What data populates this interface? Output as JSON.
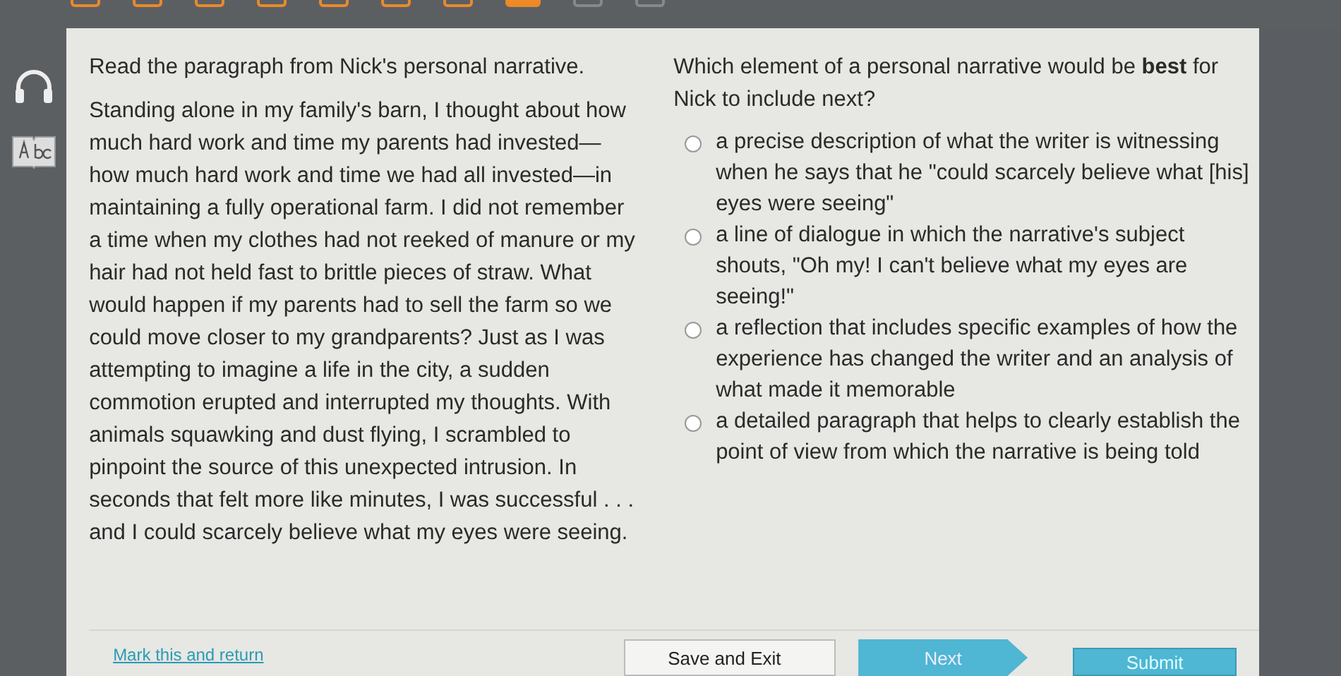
{
  "progress": [
    {
      "answered": true,
      "current": false
    },
    {
      "answered": true,
      "current": false
    },
    {
      "answered": true,
      "current": false
    },
    {
      "answered": true,
      "current": false
    },
    {
      "answered": true,
      "current": false
    },
    {
      "answered": true,
      "current": false
    },
    {
      "answered": true,
      "current": false
    },
    {
      "answered": true,
      "current": true
    },
    {
      "answered": false,
      "current": false
    },
    {
      "answered": false,
      "current": false
    }
  ],
  "passage": {
    "instruction": "Read the paragraph from Nick's personal narrative.",
    "text": "Standing alone in my family's barn, I thought about how much hard work and time my parents had invested—how much hard work and time we had all invested—in maintaining a fully operational farm. I did not remember a time when my clothes had not reeked of manure or my hair had not held fast to brittle pieces of straw. What would happen if my parents had to sell the farm so we could move closer to my grandparents? Just as I was attempting to imagine a life in the city, a sudden commotion erupted and interrupted my thoughts. With animals squawking and dust flying, I scrambled to pinpoint the source of this unexpected intrusion. In seconds that felt more like minutes, I was successful . . . and I could scarcely believe what my eyes were seeing."
  },
  "question": {
    "prompt": "Which element of a personal narrative would be **best** for Nick to include next?",
    "options": [
      {
        "text": "a precise description of what the writer is witnessing when he says that he \"could scarcely believe what [his] eyes were seeing\"",
        "selected": false
      },
      {
        "text": "a line of dialogue in which the narrative's subject shouts, \"Oh my! I can't believe what my eyes are seeing!\"",
        "selected": false
      },
      {
        "text": "a reflection that includes specific examples of how the experience has changed the writer and an analysis of what made it memorable",
        "selected": false
      },
      {
        "text": "a detailed paragraph that helps to clearly establish the point of view from which the narrative is being told",
        "selected": false
      }
    ]
  },
  "footer": {
    "link": "Mark this and return",
    "buttons": [
      {
        "kind": "plain",
        "label": "Save and Exit"
      },
      {
        "kind": "next",
        "label": "Next"
      },
      {
        "kind": "submit",
        "label": "Submit"
      }
    ]
  }
}
